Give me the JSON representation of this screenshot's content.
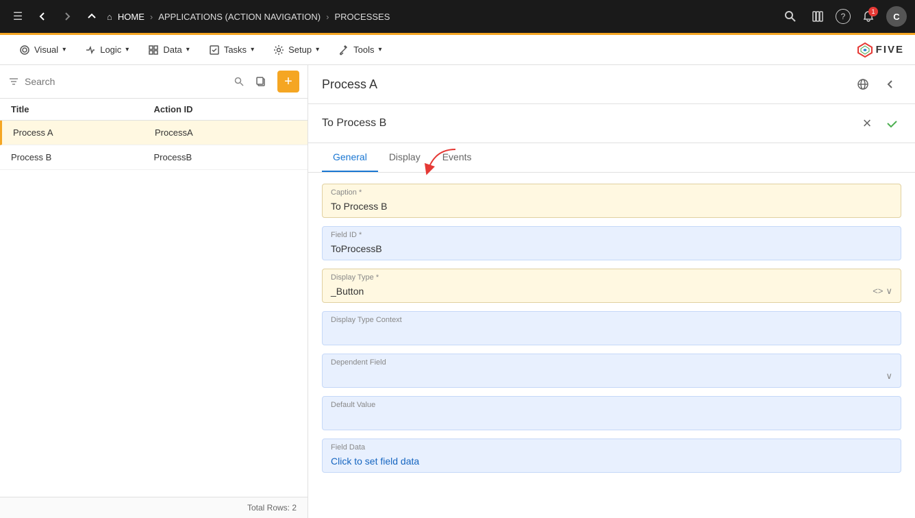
{
  "topnav": {
    "menu_icon": "☰",
    "back_icon": "←",
    "forward_icon": "→",
    "up_icon": "↑",
    "home_label": "HOME",
    "sep1": "›",
    "app_label": "APPLICATIONS (ACTION NAVIGATION)",
    "sep2": "›",
    "processes_label": "PROCESSES",
    "search_icon": "🔍",
    "books_icon": "📚",
    "help_icon": "?",
    "notification_count": "1",
    "avatar_label": "C"
  },
  "secondarynav": {
    "items": [
      {
        "id": "visual",
        "label": "Visual",
        "icon": "👁"
      },
      {
        "id": "logic",
        "label": "Logic",
        "icon": "⚙"
      },
      {
        "id": "data",
        "label": "Data",
        "icon": "⊞"
      },
      {
        "id": "tasks",
        "label": "Tasks",
        "icon": "☑"
      },
      {
        "id": "setup",
        "label": "Setup",
        "icon": "⚙"
      },
      {
        "id": "tools",
        "label": "Tools",
        "icon": "🔧"
      }
    ],
    "logo_text": "FIVE"
  },
  "sidebar": {
    "search_placeholder": "Search",
    "total_rows_label": "Total Rows: 2",
    "columns": [
      {
        "id": "title",
        "label": "Title"
      },
      {
        "id": "action_id",
        "label": "Action ID"
      }
    ],
    "rows": [
      {
        "id": "process-a",
        "title": "Process A",
        "action_id": "ProcessA",
        "active": true
      },
      {
        "id": "process-b",
        "title": "Process B",
        "action_id": "ProcessB",
        "active": false
      }
    ]
  },
  "content": {
    "title": "Process A",
    "form": {
      "title": "To Process B",
      "tabs": [
        {
          "id": "general",
          "label": "General",
          "active": true
        },
        {
          "id": "display",
          "label": "Display",
          "active": false
        },
        {
          "id": "events",
          "label": "Events",
          "active": false
        }
      ],
      "fields": [
        {
          "id": "caption",
          "label": "Caption *",
          "value": "To Process B",
          "type": "input",
          "style": "highlighted"
        },
        {
          "id": "field_id",
          "label": "Field ID *",
          "value": "ToProcessB",
          "type": "input",
          "style": "blue-bg"
        },
        {
          "id": "display_type",
          "label": "Display Type *",
          "value": "_Button",
          "type": "select",
          "style": "highlighted",
          "has_code_icon": true,
          "has_dropdown": true
        },
        {
          "id": "display_type_context",
          "label": "Display Type Context",
          "value": "",
          "type": "input",
          "style": "blue-bg"
        },
        {
          "id": "dependent_field",
          "label": "Dependent Field",
          "value": "",
          "type": "select",
          "style": "blue-bg",
          "has_dropdown": true
        },
        {
          "id": "default_value",
          "label": "Default Value",
          "value": "",
          "type": "input",
          "style": "blue-bg"
        },
        {
          "id": "field_data",
          "label": "Field Data",
          "value": "Click to set field data",
          "type": "input",
          "style": "blue-bg"
        }
      ]
    }
  },
  "icons": {
    "menu": "☰",
    "back": "←",
    "forward": "→",
    "up": "↑",
    "home": "⌂",
    "search": "🔍",
    "add": "+",
    "copy": "📋",
    "close": "×",
    "check": "✓",
    "globe": "⊕",
    "arrow_back": "←",
    "code": "<>",
    "chevron_down": "∨"
  }
}
